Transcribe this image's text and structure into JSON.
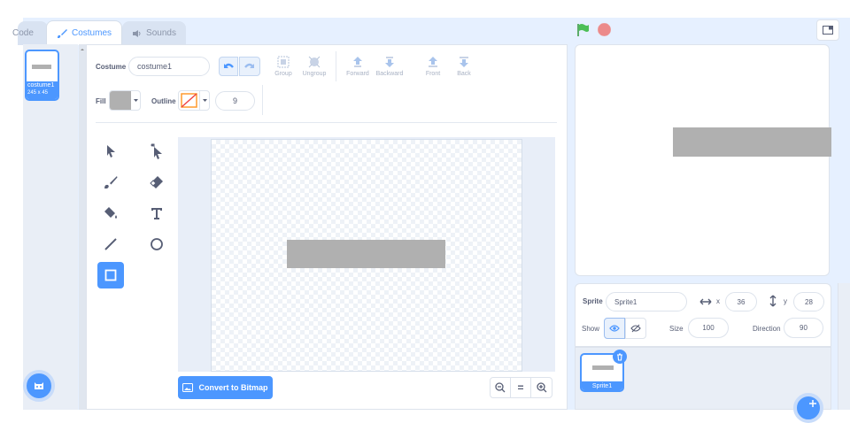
{
  "tabs": {
    "code": "Code",
    "costumes": "Costumes",
    "sounds": "Sounds"
  },
  "costume_list": {
    "name": "costume1",
    "size": "245 x 45"
  },
  "editor": {
    "costume_label": "Costume",
    "costume_name": "costume1",
    "toolbar": {
      "group": "Group",
      "ungroup": "Ungroup",
      "forward": "Forward",
      "backward": "Backward",
      "front": "Front",
      "back": "Back"
    },
    "fill_label": "Fill",
    "outline_label": "Outline",
    "outline_width": "9",
    "fill_color": "#b0b0b0",
    "convert_button": "Convert to Bitmap",
    "zoom_equal": "="
  },
  "sprite": {
    "sprite_label": "Sprite",
    "name": "Sprite1",
    "x_label": "x",
    "x": "36",
    "y_label": "y",
    "y": "28",
    "show_label": "Show",
    "size_label": "Size",
    "size": "100",
    "direction_label": "Direction",
    "direction": "90",
    "thumb_label": "Sprite1"
  },
  "colors": {
    "accent": "#4c97ff",
    "shape": "#b0b0b0",
    "flag": "#4cbf56",
    "stop": "#ec9c9c"
  }
}
